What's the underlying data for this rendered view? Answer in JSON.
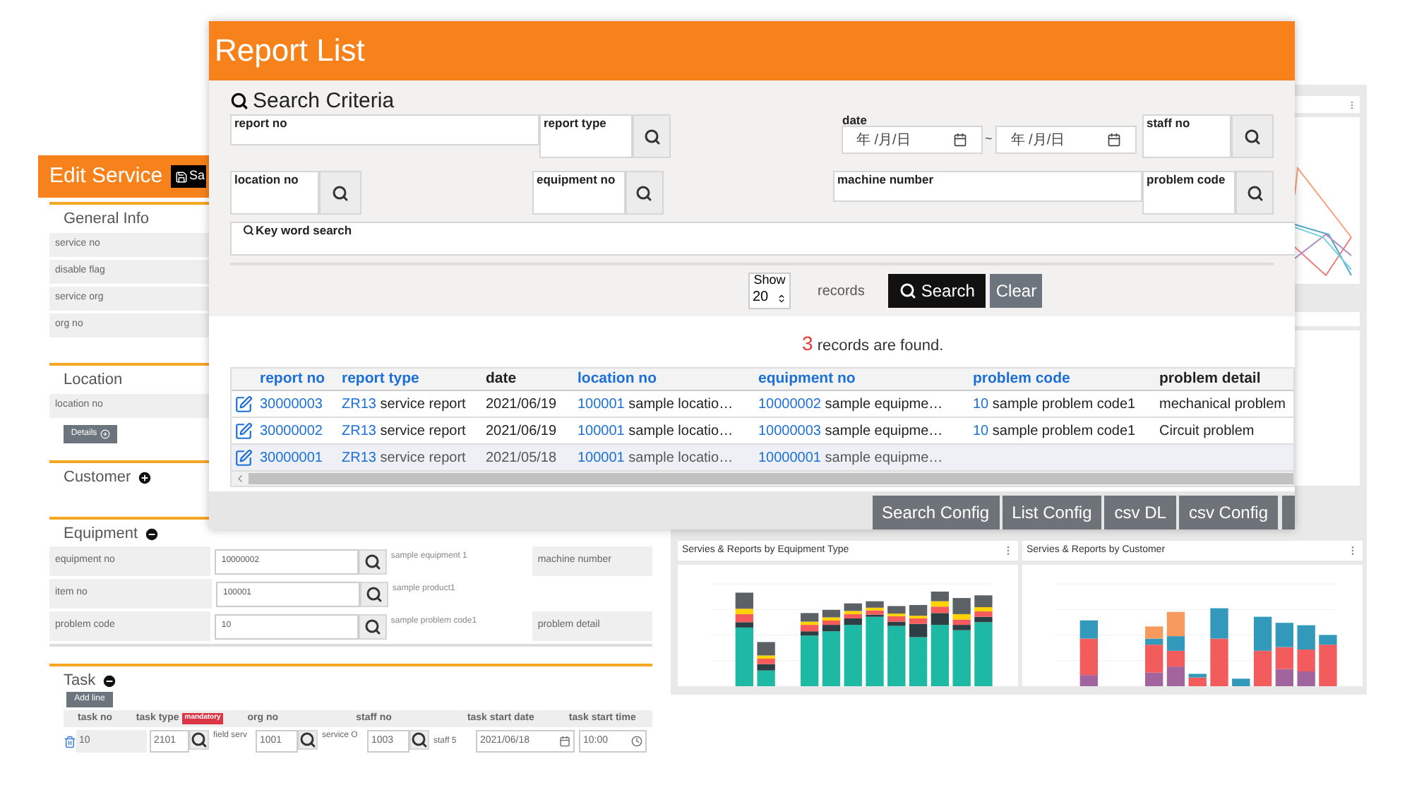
{
  "edit_service": {
    "title": "Edit Service",
    "save_button": "Sa",
    "general_info": {
      "title": "General Info",
      "fields": [
        "service no",
        "disable flag",
        "service org",
        "org no"
      ]
    },
    "location": {
      "title": "Location",
      "fields": [
        "location no"
      ],
      "details_button": "Details"
    },
    "customer": {
      "title": "Customer",
      "expanded": false
    },
    "equipment": {
      "title": "Equipment",
      "expanded": true,
      "rows": [
        {
          "label": "equipment no",
          "value": "10000002",
          "description": "sample equipment 1",
          "side_label": "machine number"
        },
        {
          "label": "item no",
          "value": "100001",
          "description": "sample product1"
        },
        {
          "label": "problem code",
          "value": "10",
          "description": "sample problem code1",
          "side_label": "problem detail"
        }
      ]
    },
    "task": {
      "title": "Task",
      "expanded": true,
      "add_button": "Add line",
      "columns": [
        {
          "label": "task no"
        },
        {
          "label": "task type",
          "badge": "mandatory"
        },
        {
          "label": "org no"
        },
        {
          "label": "staff no"
        },
        {
          "label": "task start date"
        },
        {
          "label": "task start time"
        }
      ],
      "row": {
        "task_no": "10",
        "task_type": "2101",
        "task_type_name": "field serv",
        "org_no": "1001",
        "org_name": "service O",
        "staff_no": "1003",
        "staff_name": "staff 5",
        "start_date": "2021/06/18",
        "start_time": "10:00"
      }
    }
  },
  "dashboard": {
    "charts": [
      {
        "title": "Servies & Reports by Equipment Type"
      },
      {
        "title": "Servies & Reports by Customer"
      }
    ]
  },
  "report_list": {
    "title": "Report List",
    "search_title": "Search Criteria",
    "fields": {
      "report_no": "report no",
      "report_type": "report type",
      "date": "date",
      "date_from": "年 /月/日",
      "date_sep": "~",
      "date_to": "年 /月/日",
      "staff_no": "staff no",
      "location_no": "location no",
      "equipment_no": "equipment no",
      "machine_number": "machine number",
      "problem_code": "problem code",
      "keyword": "Key word search"
    },
    "show_label": "Show",
    "show_value": "20",
    "records_label": "records",
    "search_button": "Search",
    "clear_button": "Clear",
    "found": {
      "count": "3",
      "text": "records are found."
    },
    "table": {
      "columns": [
        {
          "label": "report no",
          "sortable": true
        },
        {
          "label": "report type",
          "sortable": true
        },
        {
          "label": "date",
          "sortable": false
        },
        {
          "label": "location no",
          "sortable": true
        },
        {
          "label": "equipment no",
          "sortable": true
        },
        {
          "label": "problem code",
          "sortable": true
        },
        {
          "label": "problem detail",
          "sortable": false
        }
      ],
      "rows": [
        {
          "report_no": "30000003",
          "type_code": "ZR13",
          "type_name": "service report",
          "date": "2021/06/19",
          "location_code": "100001",
          "location_name": "sample locatio…",
          "equipment_code": "10000002",
          "equipment_name": "sample equipme…",
          "problem_code": "10",
          "problem_name": "sample problem code1",
          "problem_detail": "mechanical problem",
          "highlighted": false
        },
        {
          "report_no": "30000002",
          "type_code": "ZR13",
          "type_name": "service report",
          "date": "2021/06/19",
          "location_code": "100001",
          "location_name": "sample locatio…",
          "equipment_code": "10000003",
          "equipment_name": "sample equipme…",
          "problem_code": "10",
          "problem_name": "sample problem code1",
          "problem_detail": "Circuit problem",
          "highlighted": false
        },
        {
          "report_no": "30000001",
          "type_code": "ZR13",
          "type_name": "service report",
          "date": "2021/05/18",
          "location_code": "100001",
          "location_name": "sample locatio…",
          "equipment_code": "10000001",
          "equipment_name": "sample equipme…",
          "highlighted": true
        }
      ]
    },
    "buttons": [
      "Search Config",
      "List Config",
      "csv DL",
      "csv Config"
    ]
  }
}
